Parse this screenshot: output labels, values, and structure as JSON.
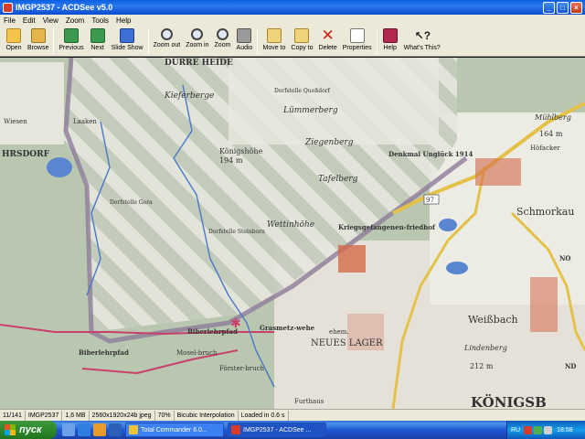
{
  "window": {
    "title": "IMGP2537 - ACDSee v5.0",
    "minimize": "_",
    "maximize": "□",
    "close": "×"
  },
  "menu": [
    "File",
    "Edit",
    "View",
    "Zoom",
    "Tools",
    "Help"
  ],
  "toolbar": {
    "open": "Open",
    "browse": "Browse",
    "previous": "Previous",
    "next": "Next",
    "slideshow": "Slide Show",
    "zoom_out": "Zoom out",
    "zoom_in": "Zoom in",
    "zoom": "Zoom",
    "audio": "Audio",
    "move_to": "Move to",
    "copy_to": "Copy to",
    "delete": "Delete",
    "properties": "Properties",
    "help": "Help",
    "whats_this": "What's This?"
  },
  "map": {
    "labels": {
      "duerre_heide": "DÜRRE HEIDE",
      "kieferberge": "Kieferberge",
      "quelle": "Dorfstelle Quoßdorf",
      "luemmerberg": "Lümmerberg",
      "koenigshoehe": "Königshöhe",
      "ziegenberg": "Ziegenberg",
      "hoehe_194": "194 m",
      "denkmal": "Denkmal Unglück 1914",
      "tafelberg": "Tafelberg",
      "wettinhoehe": "Wettinhöhe",
      "kriegsgefangenen": "Kriegsgefangenen-friedhof",
      "schmorkau": "Schmorkau",
      "muehlberg": "Mühlberg",
      "hoehe_164": "164 m",
      "hoefacker": "Höfacker",
      "laaken": "Laaken",
      "wiesen": "Wiesen",
      "hrsdorf": "HRSDORF",
      "dorfstelle_gora": "Dorfstelle Gora",
      "dorfstelle_steinborn": "Dorfstelle Steinborn",
      "biberlehrpfad": "Biberlehrpfad",
      "grassmetz": "Grasmetz-wehe",
      "neues_lager": "NEUES LAGER",
      "ehem": "ehem.",
      "weissbach": "Weißbach",
      "lindenberg": "Lindenberg",
      "hoehe_212": "212 m",
      "moselbruch": "Mosel-bruch",
      "foersterbruch": "Förster-bruch",
      "furthaus": "Furthaus",
      "koenigsbrueck": "KÖNIGSB",
      "road_97": "97",
      "biberlehrpfad2": "Biberlehrpfad",
      "no": "NO",
      "nd": "ND"
    }
  },
  "status": {
    "position": "11/141",
    "filename": "IMGP2537",
    "size": "1,6 MB",
    "dimensions": "2560x1920x24b jpeg",
    "zoom": "70%",
    "interpolation": "Bicubic Interpolation",
    "load_time": "Loaded in 0.6 s"
  },
  "taskbar": {
    "start": "пуск",
    "tasks": [
      {
        "label": "Total Commander 6.0..."
      },
      {
        "label": "IMGP2537 - ACDSee ..."
      }
    ],
    "lang": "RU",
    "clock": "18:58"
  }
}
